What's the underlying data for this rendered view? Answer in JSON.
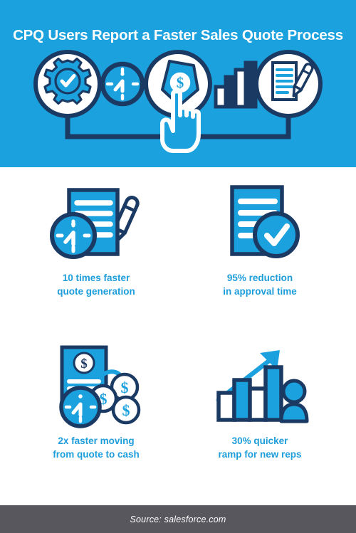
{
  "header": {
    "title": "CPQ Users Report a Faster Sales Quote Process",
    "background_color": "#1ba1dd",
    "icons": [
      {
        "name": "gear-check-icon",
        "label": "Configure"
      },
      {
        "name": "clock-icon",
        "label": "Time"
      },
      {
        "name": "price-tag-dollar-icon",
        "label": "Price"
      },
      {
        "name": "bar-chart-icon",
        "label": "Performance"
      },
      {
        "name": "document-pencil-icon",
        "label": "Quote"
      }
    ],
    "cursor": {
      "name": "pointing-hand-cursor",
      "label": "Click"
    }
  },
  "stats": [
    {
      "icon": "document-pencil-clock-icon",
      "value": "10 times faster",
      "caption_line1": "10 times faster",
      "caption_line2": "quote generation",
      "caption": "10 times faster\nquote generation"
    },
    {
      "icon": "document-check-icon",
      "value": "95% reduction",
      "caption_line1": "95% reduction",
      "caption_line2": "in approval time",
      "caption": "95% reduction\nin approval time"
    },
    {
      "icon": "invoice-coins-clock-icon",
      "value": "2x faster moving",
      "caption_line1": "2x faster moving",
      "caption_line2": "from quote to cash",
      "caption": "2x faster moving\nfrom quote to cash"
    },
    {
      "icon": "bar-chart-person-arrow-icon",
      "value": "30% quicker",
      "caption_line1": "30% quicker",
      "caption_line2": "ramp for new reps",
      "caption": "30% quicker\nramp for new reps"
    }
  ],
  "footer": {
    "source": "Source: salesforce.com",
    "background_color": "#58575d"
  },
  "colors": {
    "brand_blue": "#1ba1dd",
    "caption_blue": "#1e9ddb",
    "navy": "#1b3a63",
    "white": "#ffffff",
    "footer_gray": "#58575d"
  }
}
